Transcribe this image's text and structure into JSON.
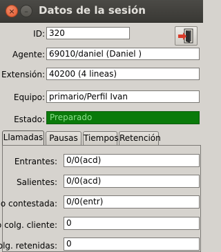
{
  "window": {
    "title": "Datos de la sesión",
    "close_glyph": "×",
    "minimize_glyph": "–"
  },
  "session": {
    "id_label": "ID:",
    "id_value": "320",
    "agent_label": "Agente:",
    "agent_value": "69010/daniel (Daniel )",
    "extension_label": "Extensión:",
    "extension_value": "40200 (4 lineas)",
    "team_label": "Equipo:",
    "team_value": "primario/Perfil Ivan",
    "status_label": "Estado:",
    "status_value": "Preparado",
    "status_color": "#0a7a0a",
    "logout_icon": "logout-door-icon"
  },
  "tabs": [
    {
      "label": "Llamadas",
      "active": true
    },
    {
      "label": "Pausas",
      "active": false
    },
    {
      "label": "Tiempos",
      "active": false
    },
    {
      "label": "Retención",
      "active": false
    }
  ],
  "calls": {
    "incoming_label": "Entrantes:",
    "incoming_value": "0/0(acd)",
    "outgoing_label": "Salientes:",
    "outgoing_value": "0/0(acd)",
    "unanswered_label": "No contestada:",
    "unanswered_value": "0/0(entr)",
    "client_hangup_label": "No colg. cliente:",
    "client_hangup_value": "0",
    "held_label": "Colg. retenidas:",
    "held_value": "0"
  }
}
